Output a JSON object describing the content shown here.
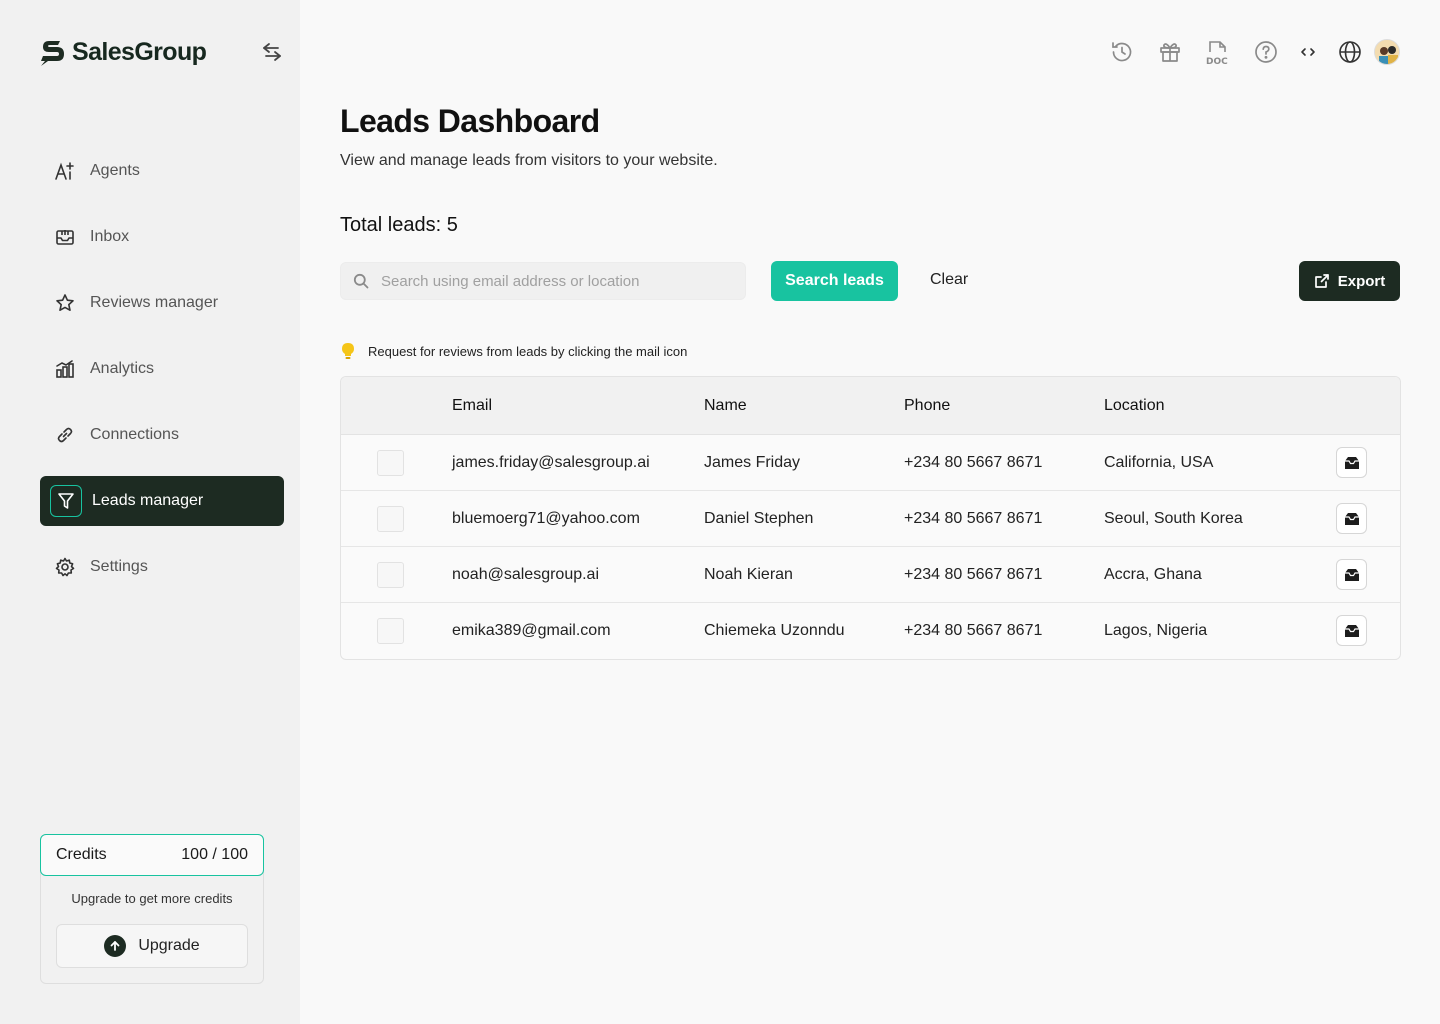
{
  "brand": {
    "name": "SalesGroup"
  },
  "sidebar": {
    "items": [
      {
        "label": "Agents",
        "icon": "ai-sparkle-icon"
      },
      {
        "label": "Inbox",
        "icon": "inbox-icon"
      },
      {
        "label": "Reviews manager",
        "icon": "star-icon"
      },
      {
        "label": "Analytics",
        "icon": "bar-chart-icon"
      },
      {
        "label": "Connections",
        "icon": "link-icon"
      },
      {
        "label": "Leads manager",
        "icon": "filter-icon",
        "active": true
      },
      {
        "label": "Settings",
        "icon": "gear-icon"
      }
    ],
    "credits": {
      "label": "Credits",
      "value": "100 / 100",
      "note": "Upgrade to get more credits",
      "upgrade_label": "Upgrade"
    }
  },
  "topbar": {
    "icons": [
      "history-icon",
      "gift-icon",
      "doc-icon",
      "help-icon",
      "code-icon",
      "globe-icon",
      "avatar"
    ]
  },
  "main": {
    "title": "Leads Dashboard",
    "subtitle": "View and manage leads from visitors to your website.",
    "total_leads": "Total leads: 5",
    "search": {
      "placeholder": "Search using email address or location",
      "value": ""
    },
    "search_button": "Search leads",
    "clear_button": "Clear",
    "export_button": "Export",
    "tip": "Request for reviews from leads by clicking the mail icon"
  },
  "table": {
    "columns": [
      "Email",
      "Name",
      "Phone",
      "Location"
    ],
    "rows": [
      {
        "email": "james.friday@salesgroup.ai",
        "name": "James Friday",
        "phone": "+234 80 5667 8671",
        "location": "California, USA"
      },
      {
        "email": "bluemoerg71@yahoo.com",
        "name": "Daniel Stephen",
        "phone": "+234 80 5667 8671",
        "location": "Seoul, South Korea"
      },
      {
        "email": "noah@salesgroup.ai",
        "name": "Noah Kieran",
        "phone": "+234 80 5667 8671",
        "location": "Accra, Ghana"
      },
      {
        "email": "emika389@gmail.com",
        "name": "Chiemeka Uzonndu",
        "phone": "+234 80 5667 8671",
        "location": "Lagos, Nigeria"
      }
    ]
  },
  "colors": {
    "accent": "#18c3a0",
    "dark": "#1d2b22",
    "sidebar_bg": "#f1f1f1",
    "page_bg": "#f9f9f9"
  }
}
